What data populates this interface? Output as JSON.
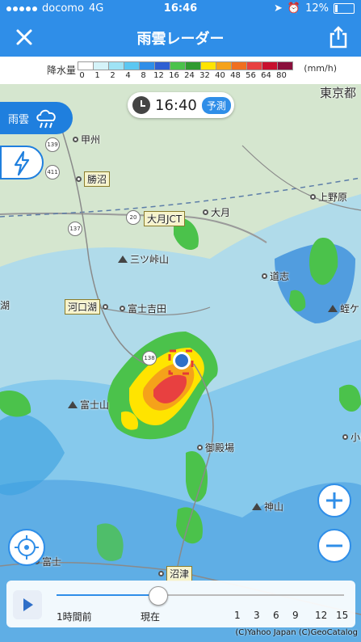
{
  "status": {
    "carrier": "docomo",
    "network": "4G",
    "time": "16:46",
    "battery": "12%"
  },
  "header": {
    "title": "雨雲レーダー",
    "close_icon": "close-icon",
    "share_icon": "share-icon"
  },
  "legend": {
    "label": "降水量",
    "unit": "(mm/h)",
    "ticks": [
      "0",
      "1",
      "2",
      "4",
      "8",
      "12",
      "16",
      "24",
      "32",
      "40",
      "48",
      "56",
      "64",
      "80"
    ],
    "colors": [
      "#ffffff",
      "#d5f3f9",
      "#9fe3f5",
      "#5cc7f2",
      "#2f8ee8",
      "#2f5fd3",
      "#4bc24b",
      "#2f9a2f",
      "#ffe400",
      "#f5a21a",
      "#f06f20",
      "#e84040",
      "#c8102e",
      "#8a0f3c"
    ]
  },
  "time_display": {
    "time": "16:40",
    "mode": "予測"
  },
  "layers": {
    "rain_label": "雨雲",
    "rain_icon": "rain-cloud-icon",
    "lightning_icon": "lightning-icon"
  },
  "places": {
    "tokyo": "東京都",
    "kofu": "甲州",
    "katsunuma": "勝沼",
    "uenohara": "上野原",
    "otsuki_jct": "大月JCT",
    "otsuki": "大月",
    "mitsutoge": "三ツ峠山",
    "doshi": "道志",
    "kawaguchiko": "河口湖",
    "fujiyoshida": "富士吉田",
    "fujisan": "富士山",
    "gotemba": "御殿場",
    "kamiyama": "神山",
    "fuji": "富士",
    "numazu": "沼津",
    "ko": "湖",
    "hiru": "蛭ケ",
    "odawara": "小田",
    "route_20": "20",
    "route_139": "139",
    "route_411": "411",
    "route_137": "137",
    "route_138": "138"
  },
  "timeline": {
    "start_label": "1時間前",
    "now_label": "現在",
    "forecast_labels": [
      "1",
      "3",
      "6",
      "9",
      "12",
      "15"
    ],
    "position": 0.35
  },
  "copyright": "(C)Yahoo Japan (C)GeoCatalog"
}
